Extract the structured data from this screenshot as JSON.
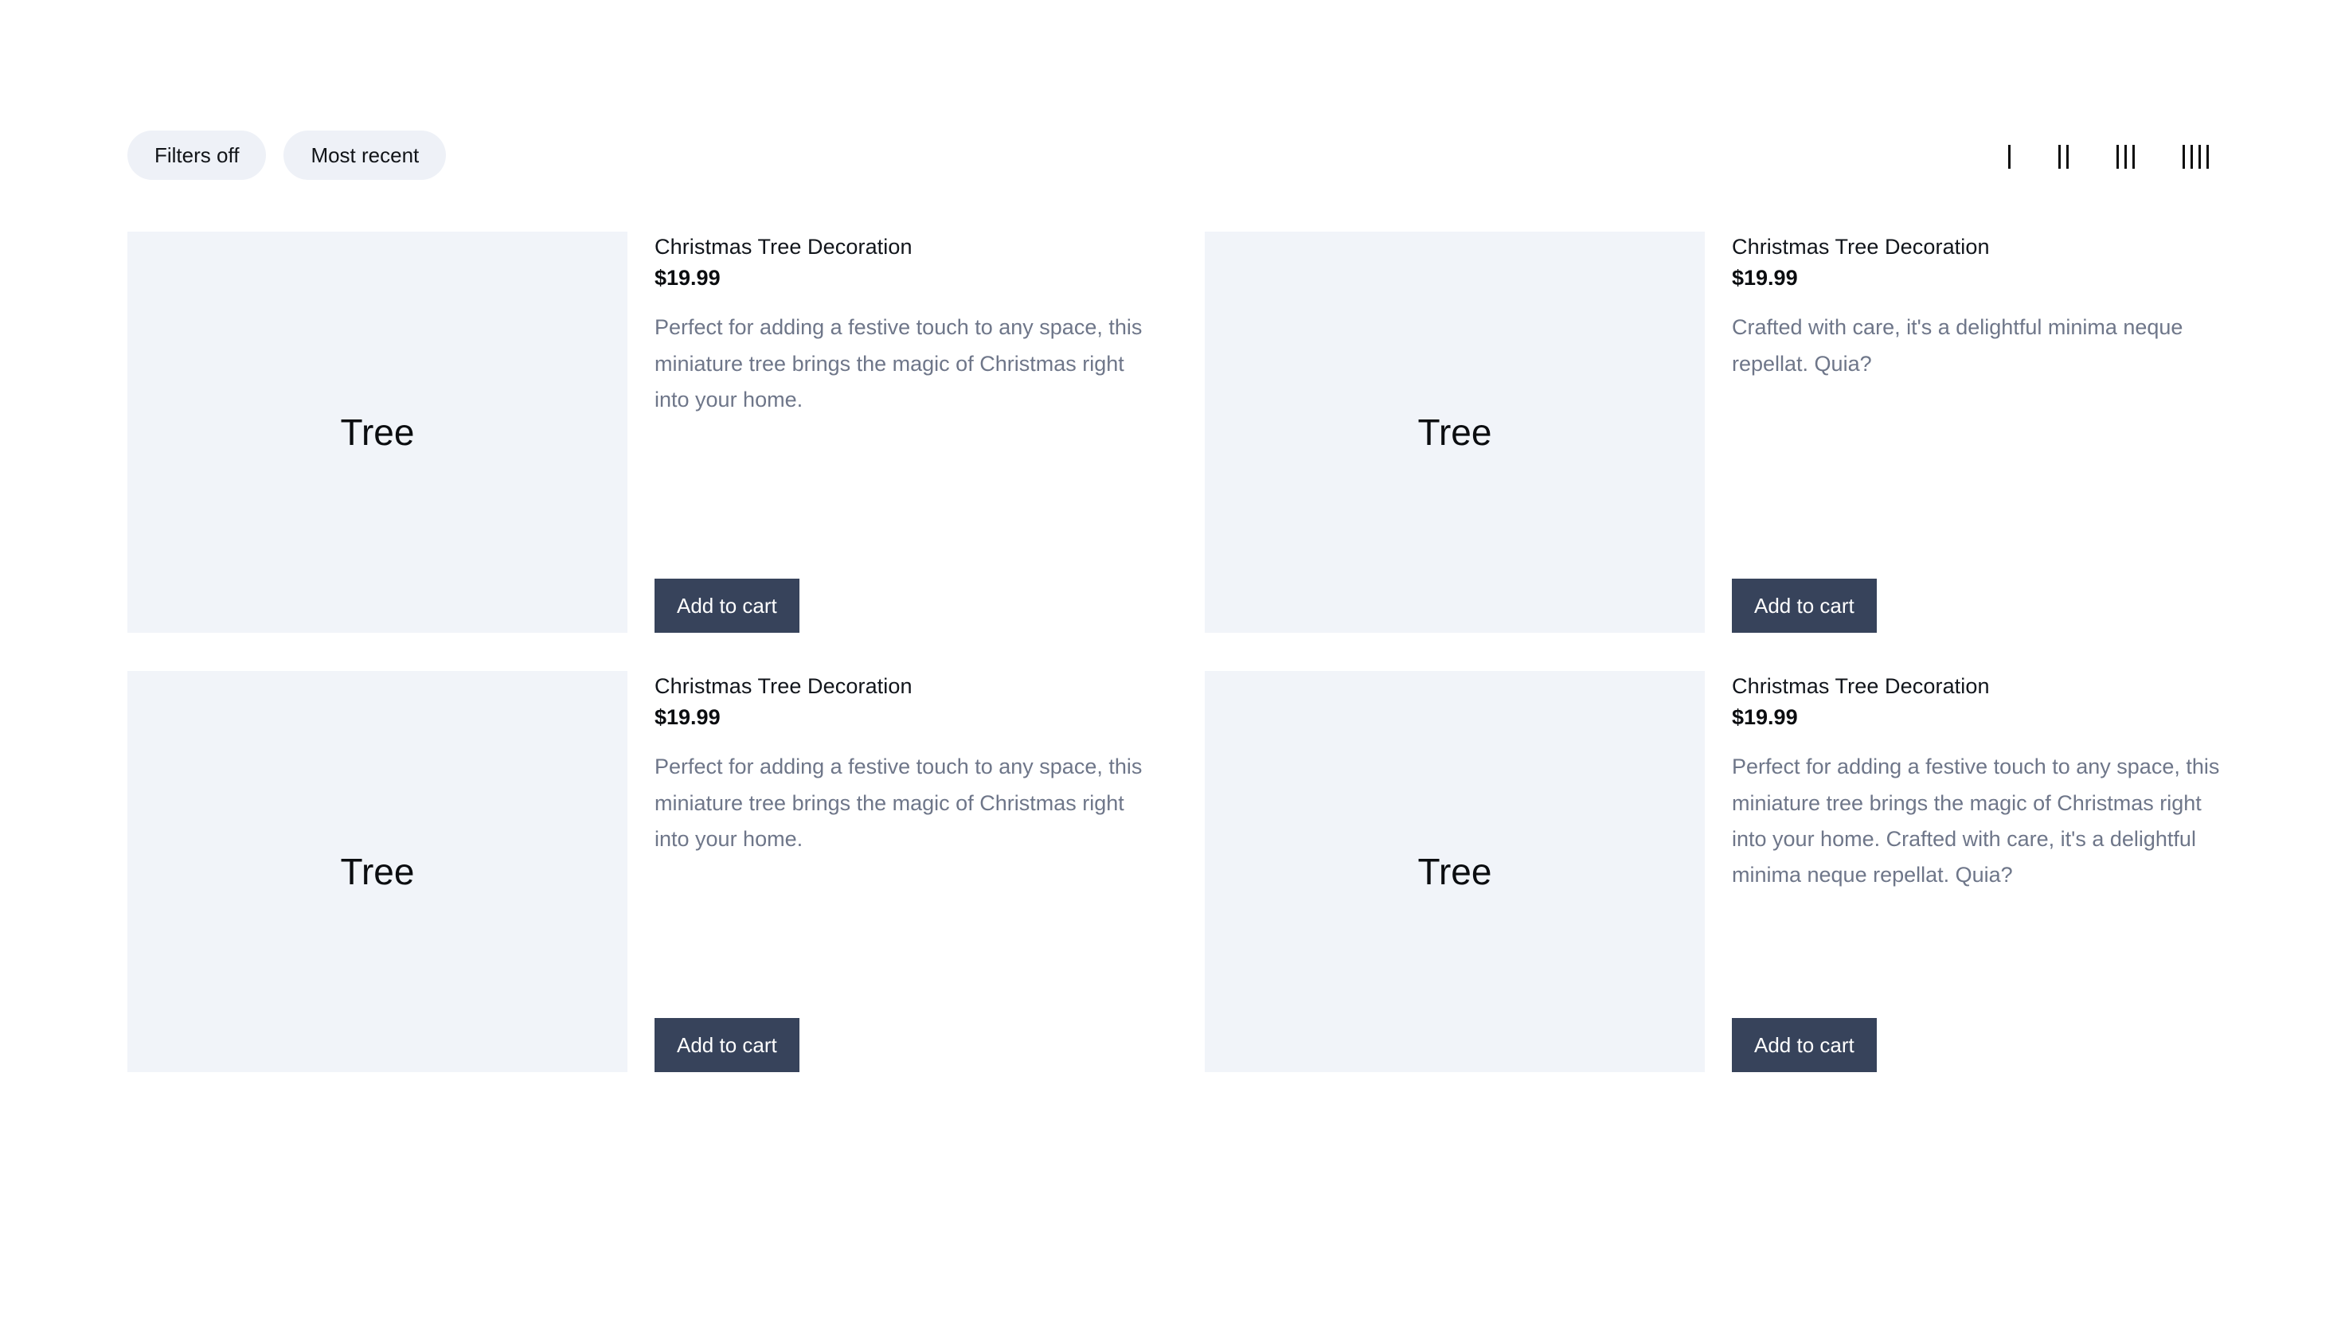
{
  "toolbar": {
    "filters_label": "Filters off",
    "sort_label": "Most recent",
    "column_options": [
      {
        "name": "one-column",
        "bars": 1
      },
      {
        "name": "two-columns",
        "bars": 2
      },
      {
        "name": "three-columns",
        "bars": 3
      },
      {
        "name": "four-columns",
        "bars": 4
      }
    ]
  },
  "colors": {
    "page_background": "#ffffff",
    "pill_background": "#eef1f7",
    "media_placeholder": "#f1f4f9",
    "button_background": "#37435b",
    "button_text": "#ffffff",
    "title_text": "#11151b",
    "description_text": "#6e7689"
  },
  "products": [
    {
      "media_label": "Tree",
      "title": "Christmas Tree Decoration",
      "price": "$19.99",
      "description": "Perfect for adding a festive touch to any space, this miniature tree brings the magic of Christmas right into your home.",
      "cta_label": "Add to cart"
    },
    {
      "media_label": "Tree",
      "title": "Christmas Tree Decoration",
      "price": "$19.99",
      "description": "Crafted with care, it's a delightful minima neque repellat. Quia?",
      "cta_label": "Add to cart"
    },
    {
      "media_label": "Tree",
      "title": "Christmas Tree Decoration",
      "price": "$19.99",
      "description": "Perfect for adding a festive touch to any space, this miniature tree brings the magic of Christmas right into your home.",
      "cta_label": "Add to cart"
    },
    {
      "media_label": "Tree",
      "title": "Christmas Tree Decoration",
      "price": "$19.99",
      "description": "Perfect for adding a festive touch to any space, this miniature tree brings the magic of Christmas right into your home. Crafted with care, it's a delightful minima neque repellat. Quia?",
      "cta_label": "Add to cart"
    }
  ]
}
